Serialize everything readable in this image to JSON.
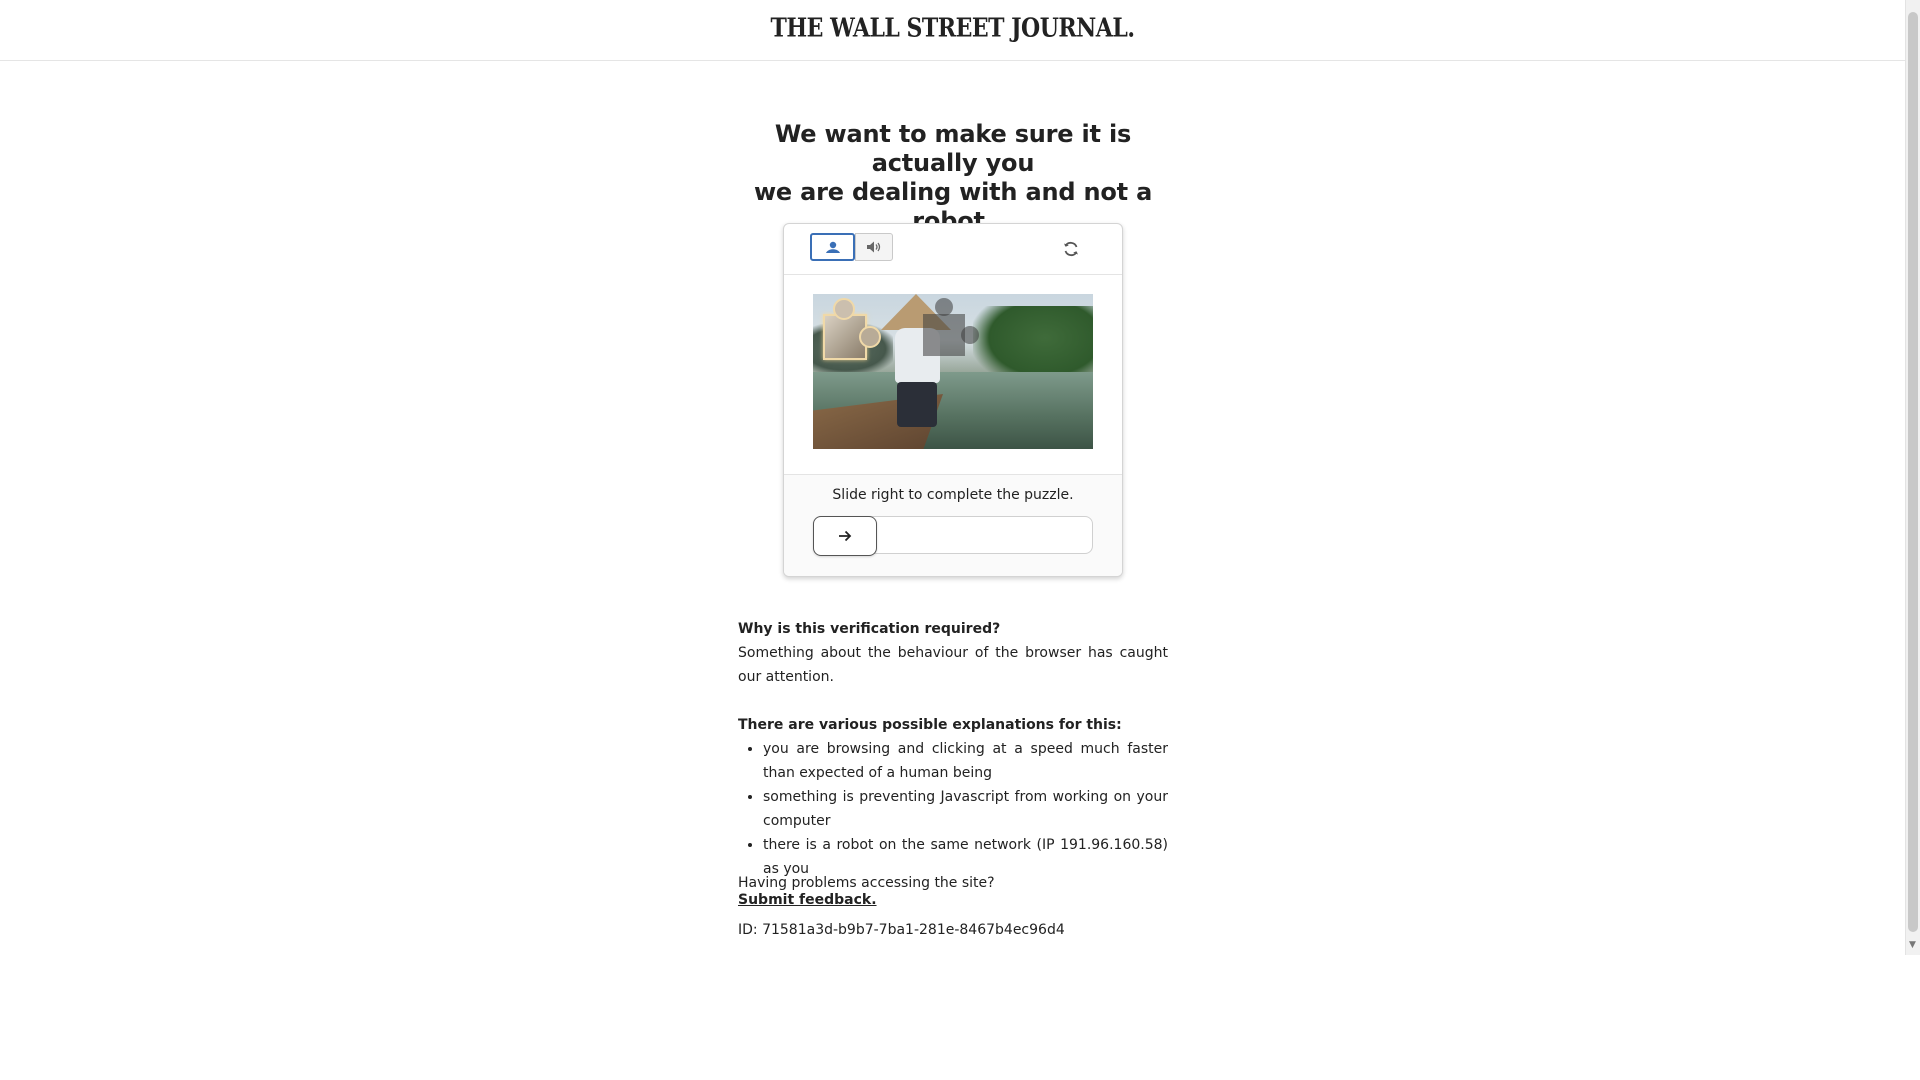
{
  "header": {
    "logo_text": "THE WALL STREET JOURNAL."
  },
  "headline": {
    "line1": "We want to make sure it is actually you",
    "line2": "we are dealing with and not a robot."
  },
  "captcha": {
    "mode_image_icon": "image-icon",
    "mode_audio_icon": "speaker-icon",
    "refresh_icon": "refresh-icon",
    "slide_instruction": "Slide right to complete the puzzle.",
    "slider_handle_icon": "arrow-right-icon",
    "slider_progress": 0
  },
  "info": {
    "why_title": "Why is this verification required?",
    "why_text": "Something about the behaviour of the browser has caught our attention.",
    "explanations_title": "There are various possible explanations for this:",
    "explanations": [
      "you are browsing and clicking at a speed much faster than expected of a human being",
      "something is preventing Javascript from working on your computer",
      "there is a robot on the same network (IP 191.96.160.58) as you"
    ]
  },
  "help": {
    "question": "Having problems accessing the site?",
    "feedback_link": "Submit feedback."
  },
  "id_line": "ID: 71581a3d-b9b7-7ba1-281e-8467b4ec96d4",
  "colors": {
    "accent": "#3a6fb6",
    "text": "#222222",
    "border": "#d4d4d4"
  }
}
